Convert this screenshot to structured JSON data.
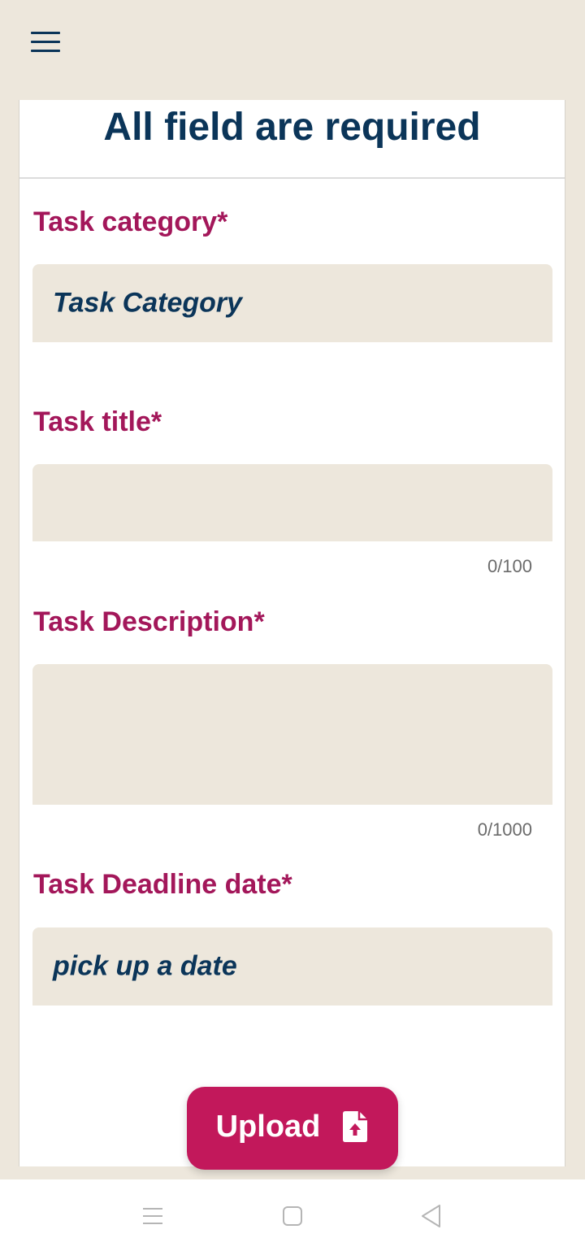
{
  "form": {
    "heading": "All field are required",
    "category": {
      "label": "Task category*",
      "value": "Task Category"
    },
    "title": {
      "label": "Task title*",
      "value": "",
      "counter": "0/100"
    },
    "description": {
      "label": "Task Description*",
      "value": "",
      "counter": "0/1000"
    },
    "deadline": {
      "label": "Task Deadline date*",
      "value": "pick up a date"
    },
    "upload_label": "Upload"
  },
  "icons": {
    "menu": "hamburger-menu-icon",
    "upload": "file-upload-icon",
    "nav_recent": "recent-apps-icon",
    "nav_home": "home-icon",
    "nav_back": "back-icon"
  },
  "colors": {
    "background": "#ede7dc",
    "heading": "#0b3559",
    "label": "#a3175a",
    "button": "#c2185b",
    "card": "#ffffff"
  }
}
